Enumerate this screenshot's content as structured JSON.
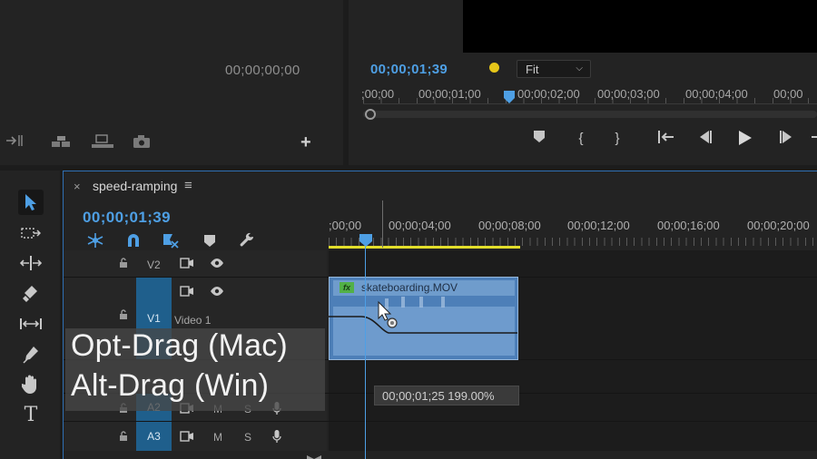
{
  "source_monitor": {
    "timecode": "00;00;00;00",
    "add_label": "+"
  },
  "program_monitor": {
    "timecode": "00;00;01;39",
    "zoom": "Fit",
    "ruler": [
      ";00;00",
      "00;00;01;00",
      "00;00;02;00",
      "00;00;03;00",
      "00;00;04;00",
      "00;00"
    ]
  },
  "timeline": {
    "tab_title": "speed-ramping",
    "timecode": "00;00;01;39",
    "ruler": [
      ";00;00",
      "00;00;04;00",
      "00;00;08;00",
      "00;00;12;00",
      "00;00;16;00",
      "00;00;20;00"
    ],
    "tracks": {
      "v2": "V2",
      "v1": "V1",
      "v1_name": "Video 1",
      "a2": "A2",
      "a3": "A3",
      "mute": "M",
      "solo": "S"
    },
    "clip": {
      "fx": "fx",
      "name": "skateboarding.MOV"
    },
    "tooltip": "00;00;01;25  199.00%"
  },
  "overlay": {
    "line1": "Opt-Drag (Mac)",
    "line2": "Alt-Drag (Win)"
  },
  "colors": {
    "accent_blue": "#4e9fe4",
    "marker_yellow": "#e6c619",
    "clip_blue": "#4d7fb8",
    "fx_green": "#52b047",
    "work_area": "#e2de2b"
  }
}
